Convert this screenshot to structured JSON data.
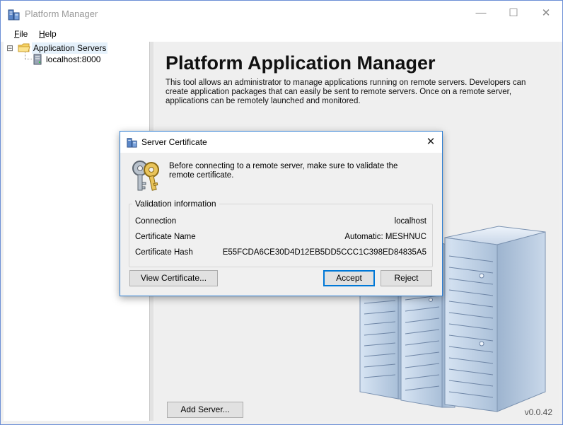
{
  "window": {
    "title": "Platform Manager"
  },
  "window_controls": {
    "minimize": "—",
    "maximize": "☐",
    "close": "✕"
  },
  "menu": {
    "file_first": "F",
    "file_rest": "ile",
    "help_first": "H",
    "help_rest": "elp"
  },
  "tree": {
    "toggle": "⊟",
    "root": "Application Servers",
    "children": [
      "localhost:8000"
    ]
  },
  "main": {
    "title": "Platform Application Manager",
    "description": "This tool allows an administrator to manage applications running on remote servers. Developers can create application packages that can easily be sent to remote servers. Once on a remote server, applications can be remotely launched and monitored.",
    "add_server_label": "Add Server...",
    "version": "v0.0.42"
  },
  "dialog": {
    "title": "Server Certificate",
    "close": "✕",
    "message": "Before connecting to a remote server, make sure to validate the remote certificate.",
    "group_title": "Validation information",
    "rows": [
      {
        "label": "Connection",
        "value": "localhost"
      },
      {
        "label": "Certificate Name",
        "value": "Automatic: MESHNUC"
      },
      {
        "label": "Certificate Hash",
        "value": "E55FCDA6CE30D4D12EB5DD5CCC1C398ED84835A5"
      }
    ],
    "view_certificate_label": "View Certificate...",
    "accept_label": "Accept",
    "reject_label": "Reject"
  },
  "icons": {
    "app": "server-app-icon",
    "folder": "folder-icon",
    "server": "server-icon",
    "keys": "keys-icon",
    "illustration": "server-rack-illustration"
  },
  "colors": {
    "accent": "#0078d7",
    "window_border": "#6b8fd6",
    "desktop": "#0b1a33"
  }
}
